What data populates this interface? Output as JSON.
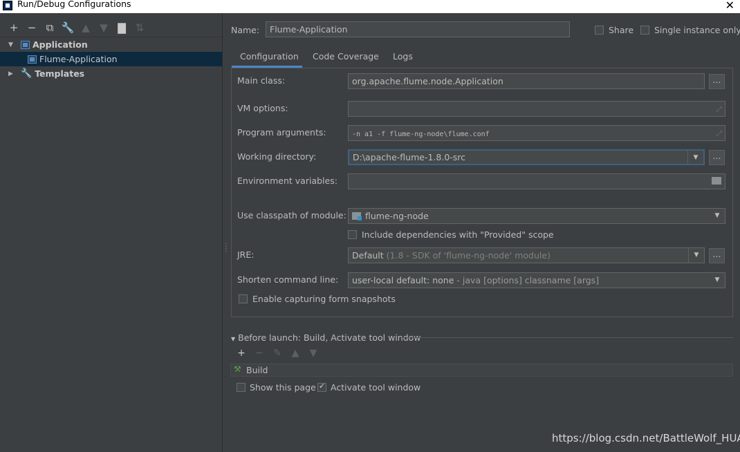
{
  "window": {
    "title": "Run/Debug Configurations",
    "close_glyph": "✕"
  },
  "left": {
    "toolbar": [
      {
        "name": "add-config-button",
        "glyph": "+",
        "dim": false
      },
      {
        "name": "remove-config-button",
        "glyph": "−",
        "dim": false
      },
      {
        "name": "copy-config-button",
        "glyph": "⧉",
        "dim": false
      },
      {
        "name": "edit-defaults-button",
        "glyph": "🔧",
        "dim": false
      },
      {
        "name": "move-up-button",
        "glyph": "▲",
        "dim": true
      },
      {
        "name": "move-down-button",
        "glyph": "▼",
        "dim": true
      },
      {
        "name": "new-folder-button",
        "glyph": "▇",
        "dim": false
      },
      {
        "name": "sort-button",
        "glyph": "⇅",
        "dim": true
      }
    ],
    "tree": {
      "application": "Application",
      "flume_application": "Flume-Application",
      "templates": "Templates"
    }
  },
  "header": {
    "name_label": "Name:",
    "name_value": "Flume-Application",
    "share_label": "Share",
    "single_instance_label": "Single instance only"
  },
  "tabs": [
    "Configuration",
    "Code Coverage",
    "Logs"
  ],
  "form": {
    "main_class_label": "Main class:",
    "main_class_value": "org.apache.flume.node.Application",
    "vm_options_label": "VM options:",
    "vm_options_value": "",
    "program_args_label": "Program arguments:",
    "program_args_value": "-n a1 -f flume-ng-node\\flume.conf",
    "working_dir_label": "Working directory:",
    "working_dir_value": "D:\\apache-flume-1.8.0-src",
    "env_label": "Environment variables:",
    "env_value": "",
    "classpath_label": "Use classpath of module:",
    "classpath_value": "flume-ng-node",
    "include_deps_label": "Include dependencies with \"Provided\" scope",
    "jre_label": "JRE:",
    "jre_value": "Default",
    "jre_hint": "(1.8 - SDK of 'flume-ng-node' module)",
    "shorten_label": "Shorten command line:",
    "shorten_value": "user-local default: none",
    "shorten_hint": "- java [options] classname [args]",
    "snapshots_label": "Enable capturing form snapshots",
    "browse_glyph": "..."
  },
  "before_launch": {
    "title": "Before launch: Build, Activate tool window",
    "build_label": "Build",
    "show_page_label": "Show this page",
    "activate_label": "Activate tool window"
  },
  "watermark": "https://blog.csdn.net/BattleWolf_HUA"
}
